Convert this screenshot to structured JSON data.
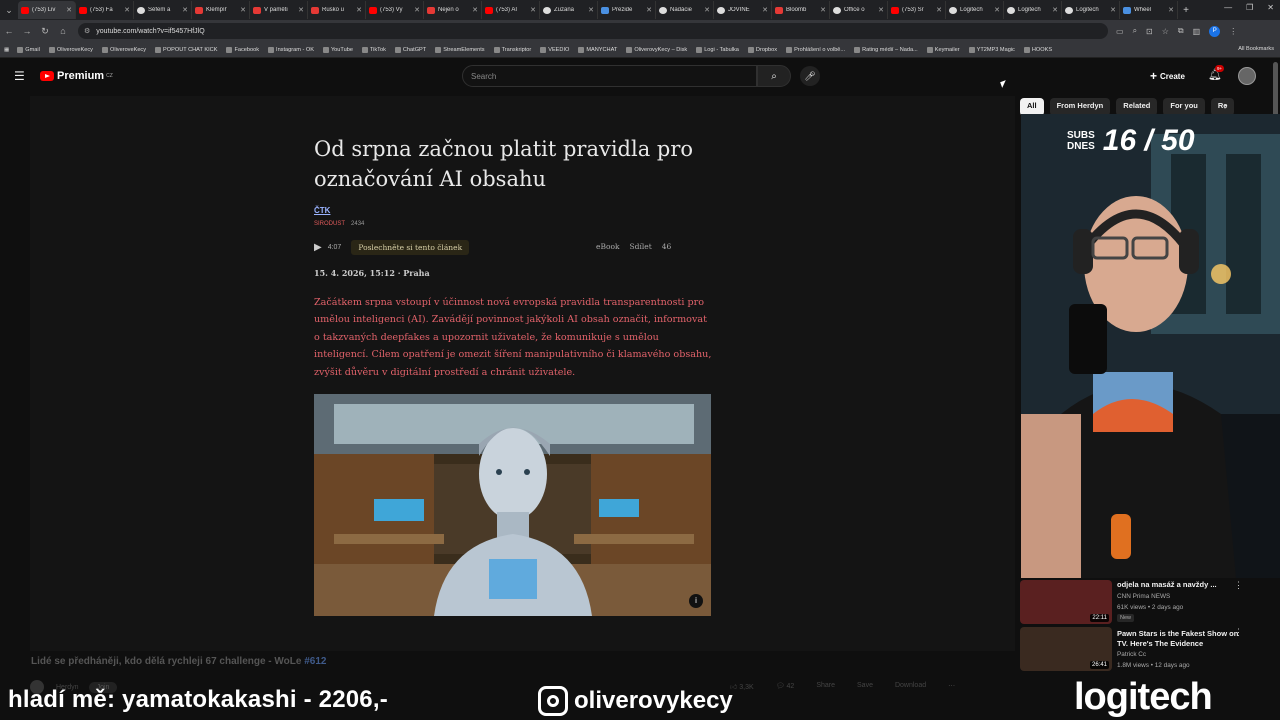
{
  "browser": {
    "tabs": [
      {
        "title": "(753) Liv",
        "fav": "yt"
      },
      {
        "title": "(753) Fa",
        "fav": "yt"
      },
      {
        "title": "Šéfem a",
        "fav": "white"
      },
      {
        "title": "Klempíř",
        "fav": "red2"
      },
      {
        "title": "V paměti",
        "fav": "red2"
      },
      {
        "title": "Rusko u",
        "fav": "red2"
      },
      {
        "title": "(753) Vy",
        "fav": "yt"
      },
      {
        "title": "Nejen o",
        "fav": "red2"
      },
      {
        "title": "(753) AI",
        "fav": "yt"
      },
      {
        "title": "Zuzana",
        "fav": "white"
      },
      {
        "title": "Prezide",
        "fav": "blue"
      },
      {
        "title": "Nadácie",
        "fav": "white"
      },
      {
        "title": "JOVINE",
        "fav": "white"
      },
      {
        "title": "Bloomb",
        "fav": "red2"
      },
      {
        "title": "Office o",
        "fav": "white"
      },
      {
        "title": "(753) Sr",
        "fav": "yt"
      },
      {
        "title": "Logitech",
        "fav": "white"
      },
      {
        "title": "Logitech",
        "fav": "white"
      },
      {
        "title": "Logitech",
        "fav": "white"
      },
      {
        "title": "Wheel",
        "fav": "blue"
      }
    ],
    "url": "youtube.com/watch?v=if5457HfJlQ",
    "bookmarks": [
      "Gmail",
      "OliveroveKecy",
      "OliveroveKecy",
      "POPOUT CHAT KICK",
      "Facebook",
      "Instagram - OK",
      "YouTube",
      "TikTok",
      "ChatGPT",
      "StreamElements",
      "Transkriptor",
      "VEEDIO",
      "MANYCHAT",
      "OliverovyKecy – Disk",
      "Logi - Tabulka",
      "Dropbox",
      "Prohlášení o volbě...",
      "Rating médií – Nada...",
      "Keymailer",
      "YT2MP3 Magic",
      "HOOKS"
    ],
    "all_bookmarks": "All Bookmarks",
    "profile_initial": "P"
  },
  "youtube": {
    "logo": "Premium",
    "logo_sup": "CZ",
    "search_placeholder": "Search",
    "create_label": "Create",
    "notif_badge": "9+",
    "chips": [
      "All",
      "From Herdyn",
      "Related",
      "For you",
      "Re"
    ]
  },
  "article": {
    "title": "Od srpna začnou platit pravidla pro označování AI obsahu",
    "source": "ČTK",
    "meta_tag": "SIRODUST",
    "views": "2434",
    "audio_time": "4:07",
    "listen_label": "Poslechněte si tento článek",
    "ebook": "eBook",
    "share": "Sdílet",
    "comments": "46",
    "date": "15. 4. 2026, 15:12",
    "location": "Praha",
    "lead": "Začátkem srpna vstoupí v účinnost nová evropská pravidla transparentnosti pro umělou inteligenci (AI). Zavádějí povinnost jakýkoli AI obsah označit, informovat o takzvaných deepfakes a upozornit uživatele, že komunikuje s umělou inteligencí. Cílem opatření je omezit šíření manipulativního či klamavého obsahu, zvýšit důvěru v digitální prostředí a chránit uživatele."
  },
  "video": {
    "title": "Lidé se předháněji, kdo dělá rychleji 67 challenge - WoLe",
    "hashtag": "#612",
    "channel": "Herdyn",
    "join": "Join",
    "likes": "3,3K",
    "dislikes": "42",
    "share": "Share",
    "save": "Save",
    "download": "Download"
  },
  "stream_overlay": {
    "donation": "hladí mě: yamatokakashi - 2206,-",
    "instagram": "oliverovykecy",
    "sponsor": "logitech",
    "subs_label_1": "SUBS",
    "subs_label_2": "DNES",
    "subs_count": "16 / 50"
  },
  "recommendations": [
    {
      "title": "odjela na masáž a navždy ...",
      "channel": "CNN Prima NEWS",
      "meta": "61K views • 2 days ago",
      "duration": "22:11",
      "badge": "New"
    },
    {
      "title": "Pawn Stars is the Fakest Show on TV. Here's The Evidence",
      "channel": "Patrick Cc",
      "meta": "1.8M views • 12 days ago",
      "duration": "26:41",
      "badge": ""
    }
  ]
}
